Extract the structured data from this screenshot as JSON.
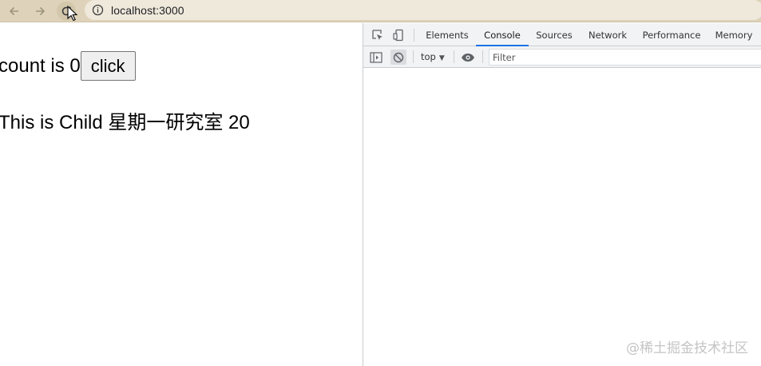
{
  "browser": {
    "url": "localhost:3000",
    "icons": {
      "back": "arrow-left-icon",
      "forward": "arrow-right-icon",
      "reload": "reload-icon",
      "info": "info-icon",
      "cursor": "mouse-pointer-icon"
    },
    "bar_color": "#ded3ba"
  },
  "page": {
    "count_text": "count is 0",
    "click_label": "click",
    "child_text": "This is Child 星期一研究室 20"
  },
  "devtools": {
    "tabs": [
      {
        "label": "Elements",
        "active": false
      },
      {
        "label": "Console",
        "active": true
      },
      {
        "label": "Sources",
        "active": false
      },
      {
        "label": "Network",
        "active": false
      },
      {
        "label": "Performance",
        "active": false
      },
      {
        "label": "Memory",
        "active": false
      }
    ],
    "icons": {
      "inspect": "inspect-element-icon",
      "device": "device-toolbar-icon",
      "sidebar": "console-sidebar-icon",
      "clear": "clear-console-icon",
      "eye": "live-expression-eye-icon"
    },
    "context": "top",
    "filter_placeholder": "Filter",
    "accent": "#1a73e8"
  },
  "watermark": "@稀土掘金技术社区"
}
